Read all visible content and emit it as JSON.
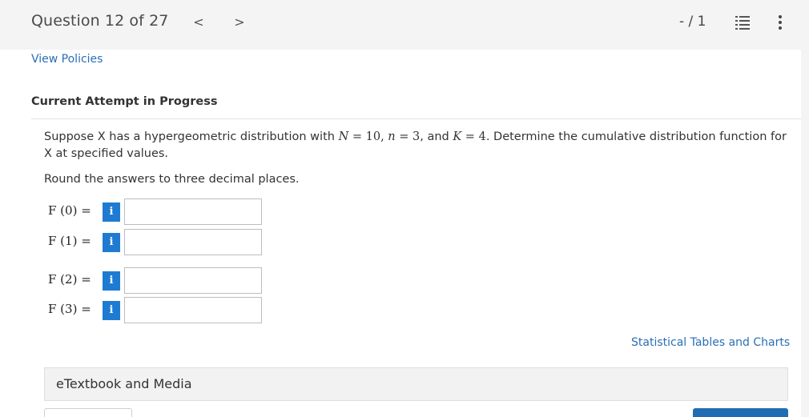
{
  "header": {
    "question_title": "Question 12 of 27",
    "prev": "<",
    "next": ">",
    "score": "- / 1"
  },
  "links": {
    "view_policies": "View Policies",
    "tables": "Statistical Tables and Charts"
  },
  "attempt_status": "Current Attempt in Progress",
  "question": {
    "stem_a": "Suppose X has a hypergeometric distribution with ",
    "N": "N",
    "eq": " = ",
    "N_val": "10",
    "comma": ", ",
    "n": "n",
    "n_val": "3",
    "and": ", and ",
    "K": "K",
    "K_val": "4",
    "stem_b": ". Determine the cumulative distribution function for X at specified values.",
    "instruction": "Round the answers to three decimal places."
  },
  "answers": [
    {
      "label": "F (0)  =",
      "value": ""
    },
    {
      "label": "F (1)  =",
      "value": ""
    },
    {
      "label": "F (2)  =",
      "value": ""
    },
    {
      "label": "F (3)  =",
      "value": ""
    }
  ],
  "info_glyph": "i",
  "etextbook": "eTextbook and Media",
  "colors": {
    "accent": "#1f7bd2",
    "link": "#2a6eb7"
  }
}
